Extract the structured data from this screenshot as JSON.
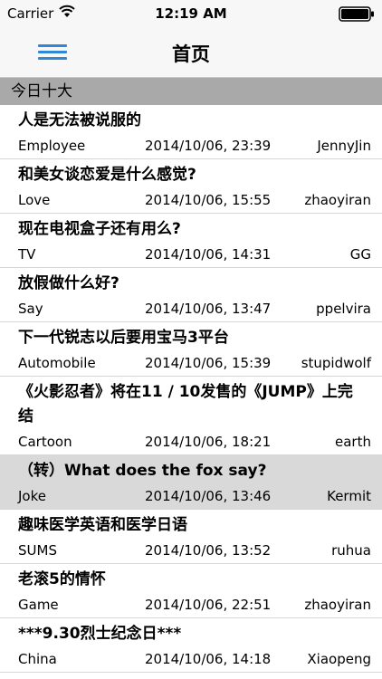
{
  "status_bar": {
    "carrier": "Carrier",
    "time": "12:19 AM",
    "icons": [
      "wifi-icon",
      "battery-icon"
    ]
  },
  "nav": {
    "title": "首页",
    "menu_icon": "hamburger-menu-icon",
    "accent_color": "#2f87d6"
  },
  "section": {
    "header": "今日十大"
  },
  "posts": [
    {
      "title": "人是无法被说服的",
      "category": "Employee",
      "date": "2014/10/06, 23:39",
      "author": "JennyJin"
    },
    {
      "title": "和美女谈恋爱是什么感觉?",
      "category": "Love",
      "date": "2014/10/06, 15:55",
      "author": "zhaoyiran"
    },
    {
      "title": "现在电视盒子还有用么?",
      "category": "TV",
      "date": "2014/10/06, 14:31",
      "author": "GG"
    },
    {
      "title": "放假做什么好?",
      "category": "Say",
      "date": "2014/10/06, 13:47",
      "author": "ppelvira"
    },
    {
      "title": "下一代锐志以后要用宝马3平台",
      "category": "Automobile",
      "date": "2014/10/06, 15:39",
      "author": "stupidwolf"
    },
    {
      "title": "《火影忍者》将在11 / 10发售的《JUMP》上完结",
      "category": "Cartoon",
      "date": "2014/10/06, 18:21",
      "author": "earth"
    },
    {
      "title": "（转）What does the fox say?",
      "category": "Joke",
      "date": "2014/10/06, 13:46",
      "author": "Kermit",
      "selected": true
    },
    {
      "title": "趣味医学英语和医学日语",
      "category": "SUMS",
      "date": "2014/10/06, 13:52",
      "author": "ruhua"
    },
    {
      "title": "老滚5的情怀",
      "category": "Game",
      "date": "2014/10/06, 22:51",
      "author": "zhaoyiran"
    },
    {
      "title": "***9.30烈士纪念日***",
      "category": "China",
      "date": "2014/10/06, 14:18",
      "author": "Xiaopeng"
    }
  ]
}
